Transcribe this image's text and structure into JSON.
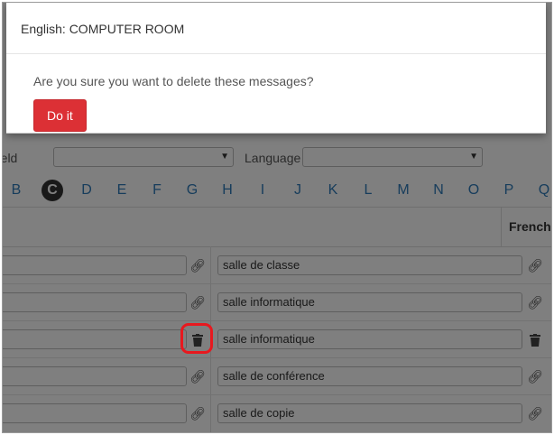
{
  "modal": {
    "title": "English: COMPUTER ROOM",
    "message": "Are you sure you want to delete these messages?",
    "confirm_label": "Do it"
  },
  "filters": {
    "field_label": "Field",
    "language_label": "Language"
  },
  "alphabet": {
    "letters": [
      "B",
      "C",
      "D",
      "E",
      "F",
      "G",
      "H",
      "I",
      "J",
      "K",
      "L",
      "M",
      "N",
      "O",
      "P",
      "Q"
    ],
    "active": "C"
  },
  "table": {
    "column_header": "French",
    "rows": [
      {
        "translation": "salle de classe"
      },
      {
        "translation": "salle informatique"
      },
      {
        "translation": "salle informatique"
      },
      {
        "translation": "salle de conférence"
      },
      {
        "translation": "salle de copie"
      }
    ]
  },
  "icons": {
    "link": "link-icon",
    "trash": "trash-icon"
  },
  "colors": {
    "danger": "#dc3035",
    "highlight": "#e8181e",
    "link_text": "#2f7ab8"
  }
}
